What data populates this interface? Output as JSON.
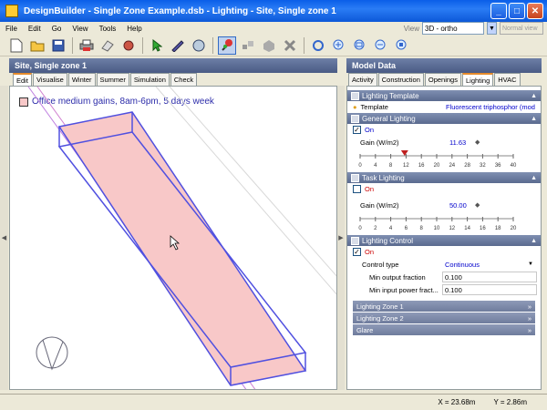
{
  "window": {
    "title": "DesignBuilder - Single Zone Example.dsb - Lighting - Site, Single zone 1"
  },
  "menu": [
    "File",
    "Edit",
    "Go",
    "View",
    "Tools",
    "Help"
  ],
  "view": {
    "label": "View",
    "selected": "3D - ortho",
    "normal_label": "Normal view"
  },
  "left_panel": {
    "title": "Site, Single zone 1",
    "tabs": [
      "Edit",
      "Visualise",
      "Winter",
      "Summer",
      "Simulation",
      "Check"
    ],
    "legend_text": "Office medium gains, 8am-6pm, 5 days week"
  },
  "right_panel": {
    "title": "Model Data",
    "tabs": [
      "Activity",
      "Construction",
      "Openings",
      "Lighting",
      "HVAC"
    ],
    "lighting_template": {
      "header": "Lighting Template",
      "label": "Template",
      "value": "Fluorescent triphosphor (mod"
    },
    "general_lighting": {
      "header": "General Lighting",
      "on_label": "On",
      "gain_label": "Gain (W/m2)",
      "gain_value": "11.63",
      "ticks": [
        "0",
        "4",
        "8",
        "12",
        "16",
        "20",
        "24",
        "28",
        "32",
        "36",
        "40"
      ],
      "level": 11.63,
      "max": 40
    },
    "task_lighting": {
      "header": "Task Lighting",
      "on_label": "On",
      "gain_label": "Gain (W/m2)",
      "gain_value": "50.00",
      "ticks": [
        "0",
        "2",
        "4",
        "6",
        "8",
        "10",
        "12",
        "14",
        "16",
        "18",
        "20"
      ]
    },
    "lighting_control": {
      "header": "Lighting Control",
      "on_label": "On",
      "control_type_label": "Control type",
      "control_type_value": "Continuous",
      "min_output_label": "Min output fraction",
      "min_output_value": "0.100",
      "min_input_label": "Min input power fract...",
      "min_input_value": "0.100"
    },
    "subsections": [
      "Lighting Zone 1",
      "Lighting Zone 2",
      "Glare"
    ]
  },
  "status": {
    "x": "X = 23.68m",
    "y": "Y = 2.86m"
  },
  "colors": {
    "accent": "#e68b2c",
    "zone_fill": "#f8c8c8",
    "zone_edge": "#5050e0",
    "header_blue": "#2a7cf5"
  }
}
